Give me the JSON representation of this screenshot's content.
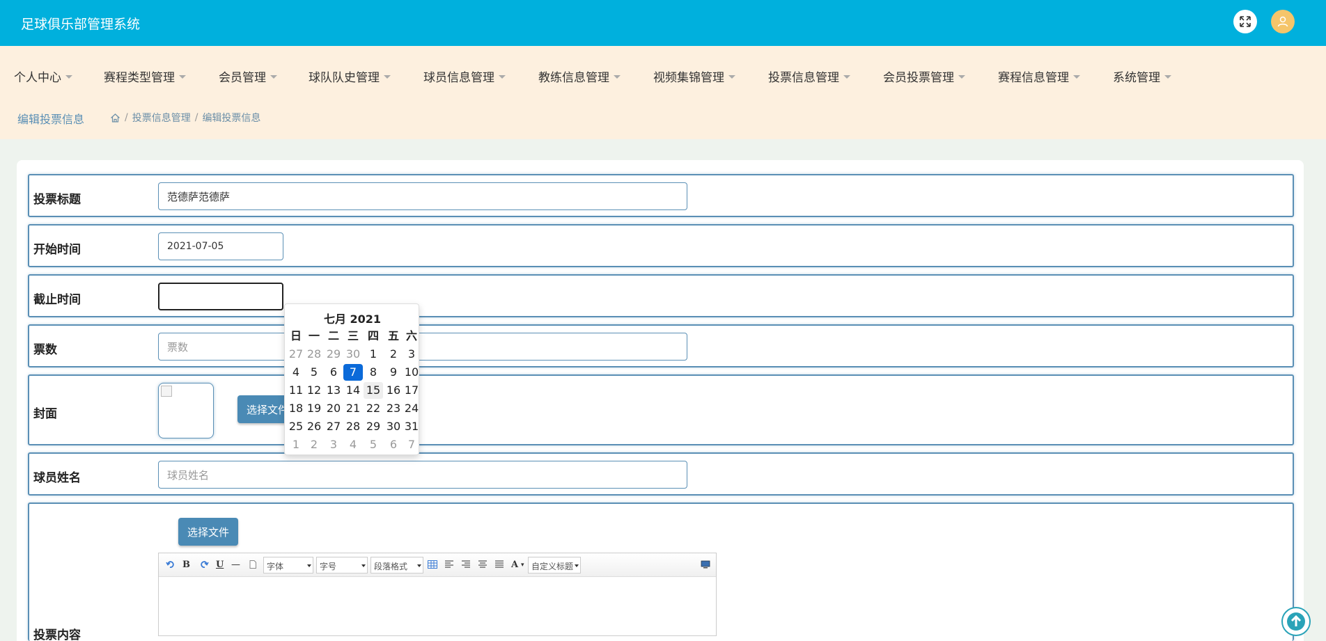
{
  "header": {
    "app_title": "足球俱乐部管理系统",
    "fullscreen_icon": "expand-icon",
    "user_icon": "user-icon"
  },
  "nav": {
    "items": [
      {
        "label": "个人中心"
      },
      {
        "label": "赛程类型管理"
      },
      {
        "label": "会员管理"
      },
      {
        "label": "球队队史管理"
      },
      {
        "label": "球员信息管理"
      },
      {
        "label": "教练信息管理"
      },
      {
        "label": "视频集锦管理"
      },
      {
        "label": "投票信息管理"
      },
      {
        "label": "会员投票管理"
      },
      {
        "label": "赛程信息管理"
      },
      {
        "label": "系统管理"
      }
    ]
  },
  "breadcrumb": {
    "title": "编辑投票信息",
    "separator": "/",
    "path": [
      "投票信息管理",
      "编辑投票信息"
    ]
  },
  "form": {
    "title_label": "投票标题",
    "title_value": "范德萨范德萨",
    "start_label": "开始时间",
    "start_value": "2021-07-05",
    "end_label": "截止时间",
    "end_value": "",
    "votes_label": "票数",
    "votes_placeholder": "票数",
    "cover_label": "封面",
    "choose_file": "选择文件",
    "player_label": "球员姓名",
    "player_placeholder": "球员姓名",
    "content_label": "投票内容",
    "content_choose_file": "选择文件"
  },
  "editor": {
    "font_family": "字体",
    "font_size": "字号",
    "paragraph": "段落格式",
    "custom_title": "自定义标题",
    "bold": "B",
    "underline": "U",
    "hr": "—",
    "font_color": "A"
  },
  "datepicker": {
    "title": "七月 2021",
    "weekdays": [
      "日",
      "一",
      "二",
      "三",
      "四",
      "五",
      "六"
    ],
    "weeks": [
      [
        "27",
        "28",
        "29",
        "30",
        "1",
        "2",
        "3"
      ],
      [
        "4",
        "5",
        "6",
        "7",
        "8",
        "9",
        "10"
      ],
      [
        "11",
        "12",
        "13",
        "14",
        "15",
        "16",
        "17"
      ],
      [
        "18",
        "19",
        "20",
        "21",
        "22",
        "23",
        "24"
      ],
      [
        "25",
        "26",
        "27",
        "28",
        "29",
        "30",
        "31"
      ],
      [
        "1",
        "2",
        "3",
        "4",
        "5",
        "6",
        "7"
      ]
    ],
    "selected_day": "7",
    "hovered_day": "15"
  },
  "colors": {
    "topbar": "#00b0dd",
    "navbar": "#fdf0df",
    "accent": "#5a8fb5",
    "button": "#4a8ab5",
    "selected": "#0b6ad9"
  }
}
